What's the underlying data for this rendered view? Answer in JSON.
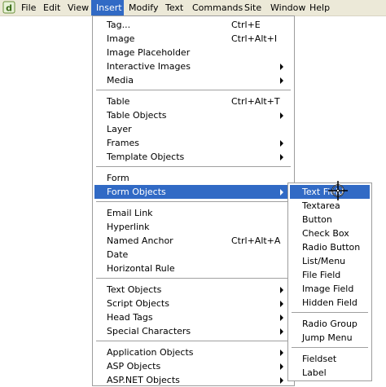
{
  "menubar": {
    "items": [
      {
        "label": "File"
      },
      {
        "label": "Edit"
      },
      {
        "label": "View"
      },
      {
        "label": "Insert"
      },
      {
        "label": "Modify"
      },
      {
        "label": "Text"
      },
      {
        "label": "Commands"
      },
      {
        "label": "Site"
      },
      {
        "label": "Window"
      },
      {
        "label": "Help"
      }
    ],
    "active": "Insert"
  },
  "insert_menu": {
    "items": [
      {
        "label": "Tag...",
        "shortcut": "Ctrl+E"
      },
      {
        "label": "Image",
        "shortcut": "Ctrl+Alt+I"
      },
      {
        "label": "Image Placeholder"
      },
      {
        "label": "Interactive Images",
        "submenu": true
      },
      {
        "label": "Media",
        "submenu": true
      },
      {
        "label": "Table",
        "shortcut": "Ctrl+Alt+T"
      },
      {
        "label": "Table Objects",
        "submenu": true
      },
      {
        "label": "Layer"
      },
      {
        "label": "Frames",
        "submenu": true
      },
      {
        "label": "Template Objects",
        "submenu": true
      },
      {
        "label": "Form"
      },
      {
        "label": "Form Objects",
        "submenu": true,
        "highlighted": true
      },
      {
        "label": "Email Link"
      },
      {
        "label": "Hyperlink"
      },
      {
        "label": "Named Anchor",
        "shortcut": "Ctrl+Alt+A"
      },
      {
        "label": "Date"
      },
      {
        "label": "Horizontal Rule"
      },
      {
        "label": "Text Objects",
        "submenu": true
      },
      {
        "label": "Script Objects",
        "submenu": true
      },
      {
        "label": "Head Tags",
        "submenu": true
      },
      {
        "label": "Special Characters",
        "submenu": true
      },
      {
        "label": "Application Objects",
        "submenu": true
      },
      {
        "label": "ASP Objects",
        "submenu": true
      },
      {
        "label": "ASP.NET Objects",
        "submenu": true
      }
    ]
  },
  "form_objects_menu": {
    "items": [
      {
        "label": "Text Field",
        "highlighted": true
      },
      {
        "label": "Textarea"
      },
      {
        "label": "Button"
      },
      {
        "label": "Check Box"
      },
      {
        "label": "Radio Button"
      },
      {
        "label": "List/Menu"
      },
      {
        "label": "File Field"
      },
      {
        "label": "Image Field"
      },
      {
        "label": "Hidden Field"
      },
      {
        "label": "Radio Group"
      },
      {
        "label": "Jump Menu"
      },
      {
        "label": "Fieldset"
      },
      {
        "label": "Label"
      }
    ]
  },
  "colors": {
    "highlight": "#316ac5",
    "menubar_bg": "#ece9d8",
    "menu_bg": "#ffffff"
  },
  "icons": {
    "app": "dreamweaver-app-icon",
    "cursor": "crosshair-cursor-icon"
  }
}
